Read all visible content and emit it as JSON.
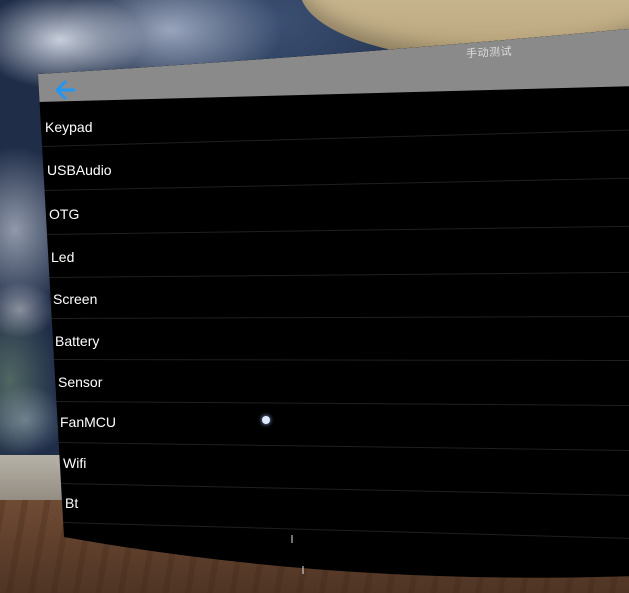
{
  "header": {
    "title": "手动测试"
  },
  "menu": {
    "items": [
      {
        "label": "Keypad"
      },
      {
        "label": "USBAudio"
      },
      {
        "label": "OTG"
      },
      {
        "label": "Led"
      },
      {
        "label": "Screen"
      },
      {
        "label": "Battery"
      },
      {
        "label": "Sensor"
      },
      {
        "label": "FanMCU"
      },
      {
        "label": "Wifi"
      },
      {
        "label": "Bt"
      }
    ]
  },
  "icons": {
    "back": "arrow-left-icon"
  },
  "colors": {
    "header_bg": "#8a8a8a",
    "back_arrow": "#2196f3",
    "panel_bg": "#000000",
    "text": "#ffffff"
  }
}
